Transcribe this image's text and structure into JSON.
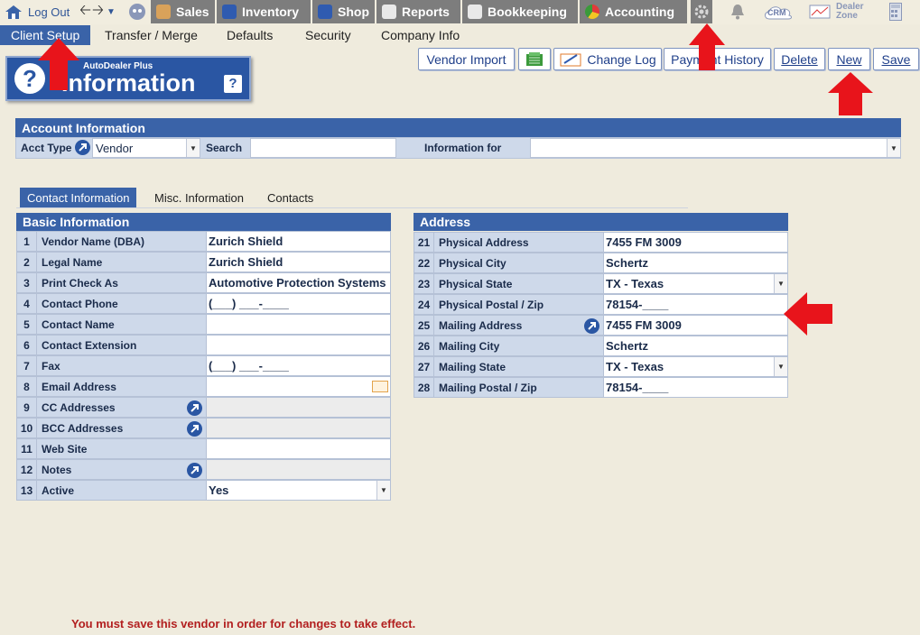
{
  "nav": {
    "logout": "Log Out",
    "sales": "Sales",
    "inventory": "Inventory",
    "shop": "Shop",
    "reports": "Reports",
    "bookkeeping": "Bookkeeping",
    "accounting": "Accounting",
    "crm": "CRM",
    "dealer_zone_1": "Dealer",
    "dealer_zone_2": "Zone"
  },
  "subnav": {
    "client_setup": "Client Setup",
    "transfer_merge": "Transfer / Merge",
    "defaults": "Defaults",
    "security": "Security",
    "company_info": "Company Info"
  },
  "banner": {
    "brand": "AutoDealer Plus",
    "title": "Information",
    "help": "?"
  },
  "actions": {
    "vendor_import": "Vendor Import",
    "change_log": "Change Log",
    "payment_history": "Payment History",
    "delete": "Delete",
    "new": "New",
    "save": "Save"
  },
  "account": {
    "header": "Account Information",
    "acct_type_label": "Acct Type",
    "acct_type_value": "Vendor",
    "search_label": "Search",
    "info_for_label": "Information for"
  },
  "tabs": {
    "contact": "Contact Information",
    "misc": "Misc. Information",
    "contacts": "Contacts"
  },
  "basic": {
    "header": "Basic Information",
    "rows": [
      {
        "num": "1",
        "label": "Vendor Name (DBA)",
        "value": "Zurich Shield"
      },
      {
        "num": "2",
        "label": "Legal Name",
        "value": "Zurich Shield"
      },
      {
        "num": "3",
        "label": "Print Check As",
        "value": "Automotive Protection Systems"
      },
      {
        "num": "4",
        "label": "Contact Phone",
        "value": "(___) ___-____"
      },
      {
        "num": "5",
        "label": "Contact Name",
        "value": ""
      },
      {
        "num": "6",
        "label": "Contact Extension",
        "value": ""
      },
      {
        "num": "7",
        "label": "Fax",
        "value": "(___) ___-____"
      },
      {
        "num": "8",
        "label": "Email Address",
        "value": ""
      },
      {
        "num": "9",
        "label": "CC Addresses",
        "value": ""
      },
      {
        "num": "10",
        "label": "BCC Addresses",
        "value": ""
      },
      {
        "num": "11",
        "label": "Web Site",
        "value": ""
      },
      {
        "num": "12",
        "label": "Notes",
        "value": ""
      },
      {
        "num": "13",
        "label": "Active",
        "value": "Yes"
      }
    ]
  },
  "address": {
    "header": "Address",
    "rows": [
      {
        "num": "21",
        "label": "Physical Address",
        "value": "7455 FM 3009"
      },
      {
        "num": "22",
        "label": "Physical City",
        "value": "Schertz"
      },
      {
        "num": "23",
        "label": "Physical State",
        "value": "TX - Texas"
      },
      {
        "num": "24",
        "label": "Physical Postal / Zip",
        "value": "78154-____"
      },
      {
        "num": "25",
        "label": "Mailing Address",
        "value": "7455 FM 3009"
      },
      {
        "num": "26",
        "label": "Mailing City",
        "value": "Schertz"
      },
      {
        "num": "27",
        "label": "Mailing State",
        "value": "TX - Texas"
      },
      {
        "num": "28",
        "label": "Mailing Postal / Zip",
        "value": "78154-____"
      }
    ]
  },
  "footer": {
    "message": "You must save this vendor in order for changes to take effect."
  },
  "colors": {
    "accent": "#3a63a8",
    "arrow": "#e8141b",
    "warning": "#b21f1f"
  }
}
